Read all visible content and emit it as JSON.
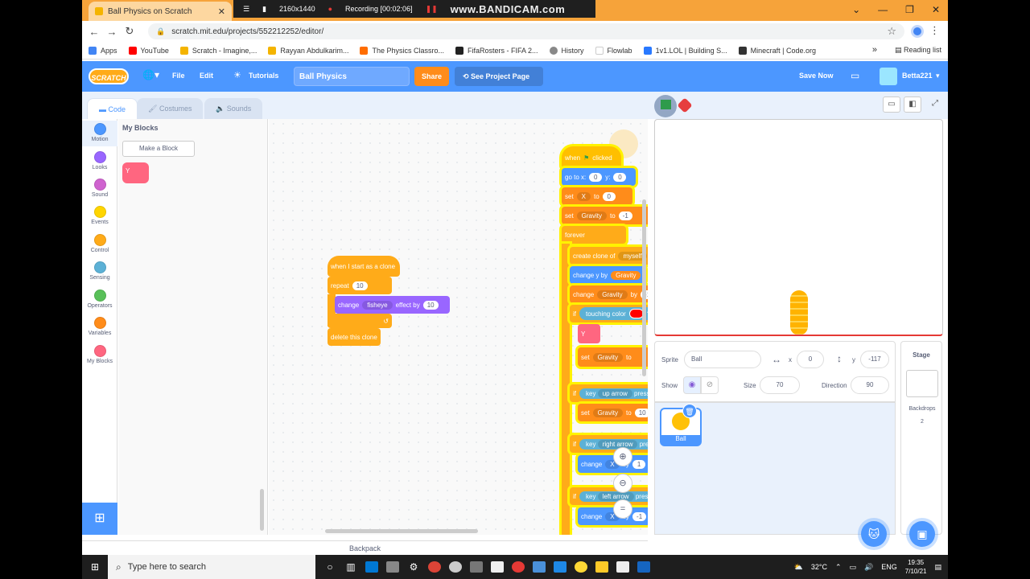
{
  "browser": {
    "tab_title": "Ball Physics on Scratch",
    "url": "scratch.mit.edu/projects/552212252/editor/",
    "recording": {
      "resolution": "2160x1440",
      "status": "Recording [00:02:06]",
      "brand": "www.BANDICAM.com"
    },
    "bookmarks": [
      {
        "label": "Apps",
        "color": "#4285f4"
      },
      {
        "label": "YouTube",
        "color": "#ff0000"
      },
      {
        "label": "Scratch - Imagine,...",
        "color": "#f4b400"
      },
      {
        "label": "Rayyan Abdulkarim...",
        "color": "#f4b400"
      },
      {
        "label": "The Physics Classro...",
        "color": "#ff6d00"
      },
      {
        "label": "FifaRosters - FIFA 2...",
        "color": "#222222"
      },
      {
        "label": "History",
        "color": "#888888"
      },
      {
        "label": "Flowlab",
        "color": "#ffffff"
      },
      {
        "label": "1v1.LOL | Building S...",
        "color": "#2979ff"
      },
      {
        "label": "Minecraft | Code.org",
        "color": "#333333"
      }
    ],
    "reading_list": "Reading list"
  },
  "menu": {
    "logo": "SCRATCH",
    "file": "File",
    "edit": "Edit",
    "tutorials": "Tutorials",
    "project_title": "Ball Physics",
    "share": "Share",
    "see_project": "See Project Page",
    "save_now": "Save Now",
    "username": "Betta221"
  },
  "editor_tabs": {
    "code": "Code",
    "costumes": "Costumes",
    "sounds": "Sounds"
  },
  "categories": [
    {
      "label": "Motion",
      "color": "#4c97ff"
    },
    {
      "label": "Looks",
      "color": "#9966ff"
    },
    {
      "label": "Sound",
      "color": "#cf63cf"
    },
    {
      "label": "Events",
      "color": "#ffd500"
    },
    {
      "label": "Control",
      "color": "#ffab19"
    },
    {
      "label": "Sensing",
      "color": "#5cb1d6"
    },
    {
      "label": "Operators",
      "color": "#59c059"
    },
    {
      "label": "Variables",
      "color": "#ff8c1a"
    },
    {
      "label": "My Blocks",
      "color": "#ff6680"
    }
  ],
  "palette": {
    "title": "My Blocks",
    "make_block": "Make a Block",
    "custom_block": "Y"
  },
  "clone_script": {
    "hat": "when I start as a clone",
    "repeat": "repeat",
    "repeat_count": "10",
    "change": "change",
    "effect": "fisheye",
    "effect_by": "effect by",
    "effect_value": "10",
    "delete": "delete this clone"
  },
  "main_script": {
    "hat_when": "when",
    "hat_clicked": "clicked",
    "goto": "go to x:",
    "goto_x": "0",
    "goto_y_label": "y:",
    "goto_y": "0",
    "set": "set",
    "var_x": "X",
    "to": "to",
    "set_x_val": "0",
    "var_gravity": "Gravity",
    "set_gravity_val": "-1",
    "forever": "forever",
    "create_clone": "create clone of",
    "clone_target": "myself",
    "change_y": "change y by",
    "change": "change",
    "by": "by",
    "change_gravity_val": "-1",
    "if": "if",
    "then": "then",
    "touching_color": "touching color",
    "question": "?",
    "custom_y": "Y",
    "minus": "-",
    "divide": "/",
    "zero": "0",
    "two": "2",
    "key": "key",
    "pressed": "pressed?",
    "up_arrow": "up arrow",
    "right_arrow": "right arrow",
    "left_arrow": "left arrow",
    "set_gravity_10": "10",
    "change_x_right": "1",
    "change_x_left": "-1"
  },
  "backpack": "Backpack",
  "sprite_info": {
    "sprite_label": "Sprite",
    "sprite_name": "Ball",
    "x_label": "x",
    "x_value": "0",
    "y_label": "y",
    "y_value": "-117",
    "show_label": "Show",
    "size_label": "Size",
    "size_value": "70",
    "direction_label": "Direction",
    "direction_value": "90"
  },
  "sprites": [
    {
      "name": "Ball"
    }
  ],
  "stage_panel": {
    "title": "Stage",
    "backdrops_label": "Backdrops",
    "backdrops_count": "2"
  },
  "taskbar": {
    "search_placeholder": "Type here to search",
    "temperature": "32°C",
    "language": "ENG",
    "time": "19:35",
    "date": "7/10/21"
  }
}
